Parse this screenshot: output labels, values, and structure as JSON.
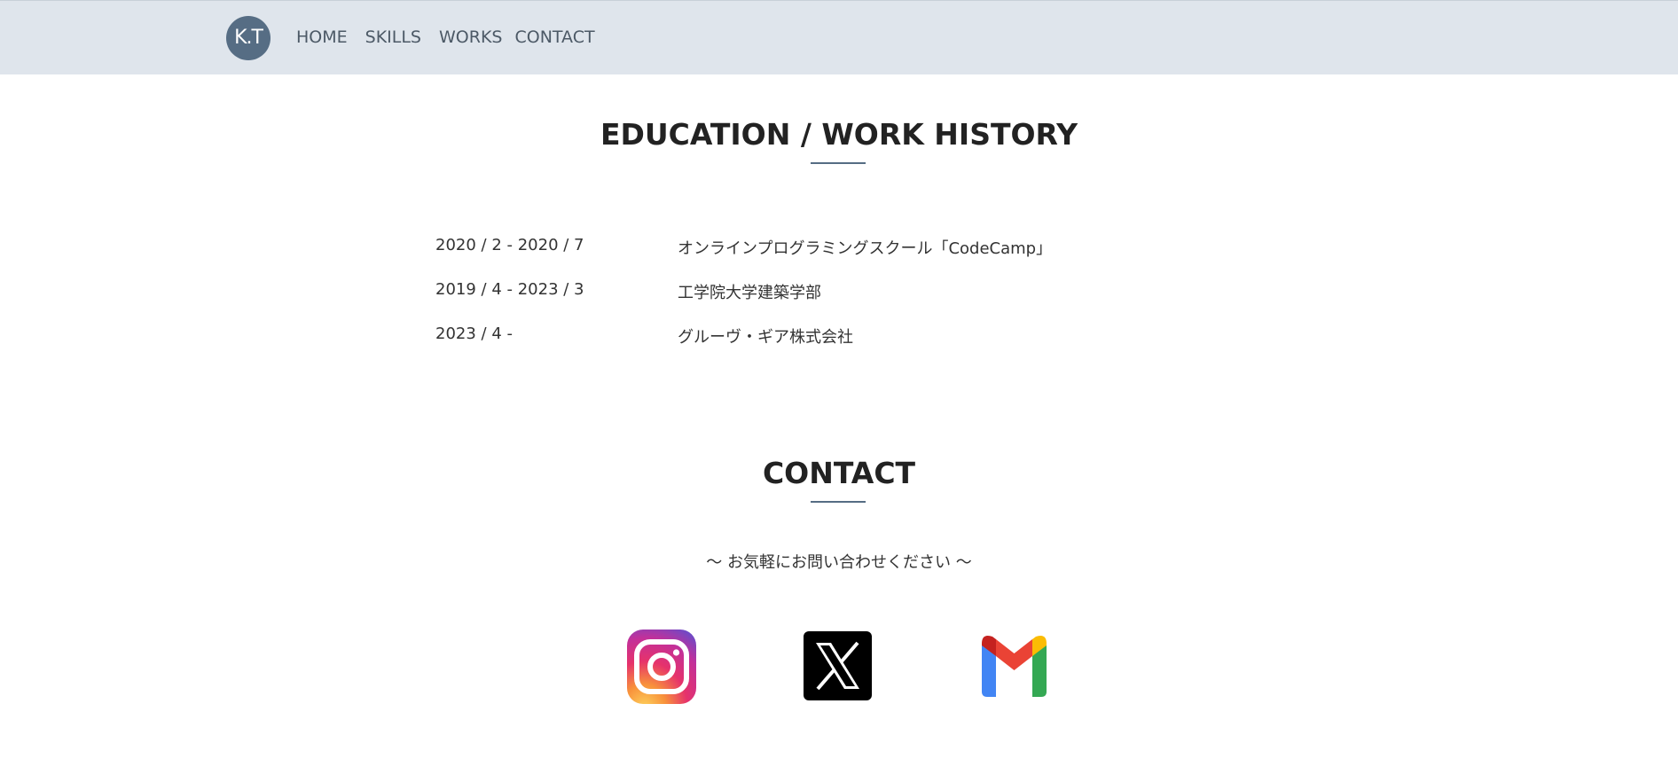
{
  "header": {
    "logo_text": "K.T",
    "nav": [
      {
        "label": "HOME"
      },
      {
        "label": "SKILLS"
      },
      {
        "label": "WORKS"
      },
      {
        "label": "CONTACT"
      }
    ]
  },
  "education": {
    "title": "EDUCATION / WORK HISTORY",
    "rows": [
      {
        "date": "2020 / 2 - 2020 / 7",
        "desc": "オンラインプログラミングスクール「CodeCamp」"
      },
      {
        "date": "2019 / 4 - 2023 / 3",
        "desc": "工学院大学建築学部"
      },
      {
        "date": "2023 / 4 -",
        "desc": "グルーヴ・ギア株式会社"
      }
    ]
  },
  "contact": {
    "title": "CONTACT",
    "subtitle": "〜 お気軽にお問い合わせください 〜",
    "links": [
      {
        "icon": "instagram-icon"
      },
      {
        "icon": "x-icon"
      },
      {
        "icon": "gmail-icon"
      }
    ]
  },
  "colors": {
    "header_bg": "#dfe5ec",
    "accent": "#566d84"
  }
}
